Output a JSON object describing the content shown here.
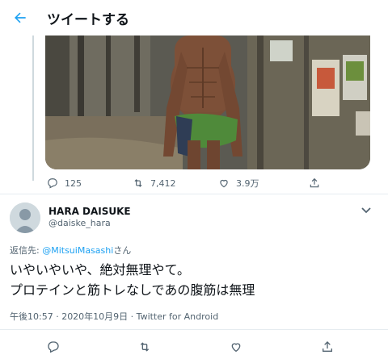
{
  "header": {
    "title": "ツイートする"
  },
  "prev_tweet": {
    "actions": [
      {
        "icon": "reply-icon",
        "count": "125"
      },
      {
        "icon": "retweet-icon",
        "count": "7,412"
      },
      {
        "icon": "like-icon",
        "count": "3.9万"
      },
      {
        "icon": "share-icon",
        "count": ""
      }
    ]
  },
  "tweet": {
    "display_name": "HARA DAISUKE",
    "handle": "@daiske_hara",
    "reply_prefix": "返信先: ",
    "reply_mention": "@MitsuiMasashi",
    "reply_suffix": "さん",
    "text_line1": "いやいやいや、絶対無理やて。",
    "text_line2": "プロテインと筋トレなしであの腹筋は無理",
    "timestamp": "午後10:57 · 2020年10月9日 · Twitter for Android"
  },
  "colors": {
    "accent": "#1da1f2",
    "muted": "#536471",
    "text": "#0f1419"
  }
}
